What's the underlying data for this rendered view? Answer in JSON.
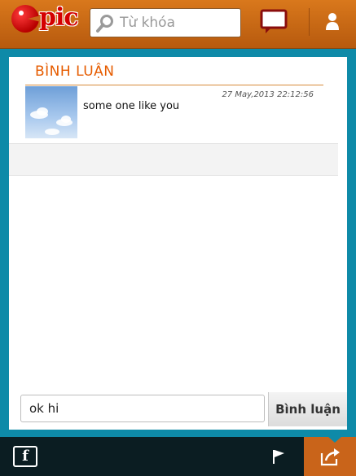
{
  "header": {
    "logo_text": "pic",
    "search_placeholder": "Từ khóa",
    "icons": {
      "search": "search-icon",
      "chat": "chat-bubble-icon",
      "user": "user-icon"
    }
  },
  "comments": {
    "title": "BÌNH LUẬN",
    "items": [
      {
        "text": "some one like you",
        "date": "27 May,2013 22:12:56"
      }
    ]
  },
  "composer": {
    "value": "ok hi",
    "submit_label": "Bình luận"
  },
  "bottombar": {
    "facebook_label": "f",
    "icons": {
      "facebook": "facebook-icon",
      "flag": "flag-icon",
      "share": "share-icon"
    }
  },
  "colors": {
    "header": "#c8661a",
    "accent": "#e65c00",
    "background": "#0e8aa8",
    "bottombar": "#0b1d22"
  }
}
